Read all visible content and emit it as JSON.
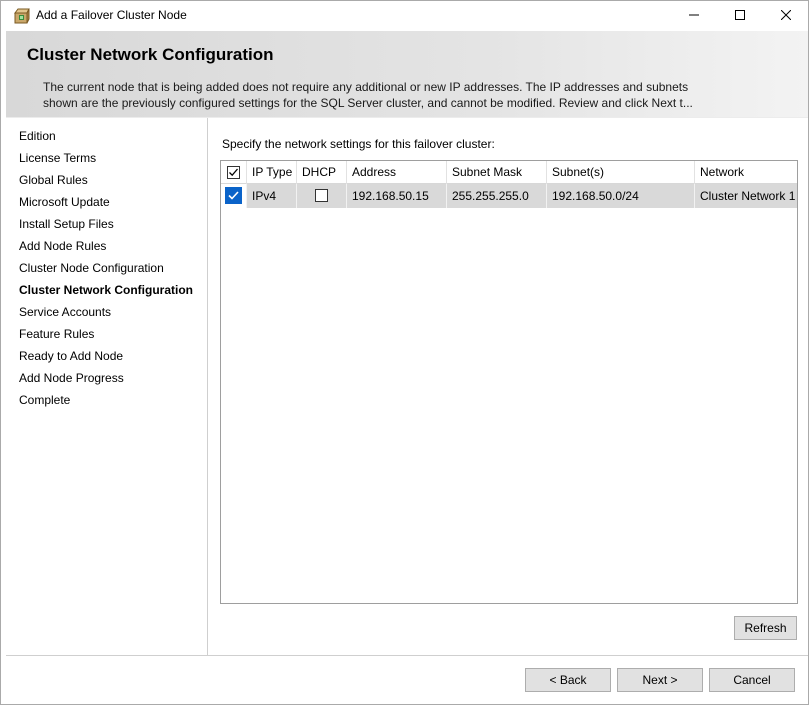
{
  "window": {
    "title": "Add a Failover Cluster Node"
  },
  "header": {
    "title": "Cluster Network Configuration",
    "desc_line1": "The current node that is being added does not require any additional or new IP addresses.  The IP addresses and subnets",
    "desc_line2": "shown are the previously configured settings for the SQL Server cluster, and cannot be modified. Review and click Next t..."
  },
  "nav": {
    "items": [
      {
        "label": "Edition"
      },
      {
        "label": "License Terms"
      },
      {
        "label": "Global Rules"
      },
      {
        "label": "Microsoft Update"
      },
      {
        "label": "Install Setup Files"
      },
      {
        "label": "Add Node Rules"
      },
      {
        "label": "Cluster Node Configuration"
      },
      {
        "label": "Cluster Network Configuration",
        "active": true
      },
      {
        "label": "Service Accounts"
      },
      {
        "label": "Feature Rules"
      },
      {
        "label": "Ready to Add Node"
      },
      {
        "label": "Add Node Progress"
      },
      {
        "label": "Complete"
      }
    ]
  },
  "main": {
    "prompt": "Specify the network settings for this failover cluster:",
    "columns": {
      "ip_type": "IP Type",
      "dhcp": "DHCP",
      "address": "Address",
      "subnet_mask": "Subnet Mask",
      "subnets": "Subnet(s)",
      "network": "Network"
    },
    "rows": [
      {
        "selected": true,
        "ip_type": "IPv4",
        "dhcp": false,
        "address": "192.168.50.15",
        "subnet_mask": "255.255.255.0",
        "subnets": "192.168.50.0/24",
        "network": "Cluster Network 1"
      }
    ]
  },
  "buttons": {
    "refresh": "Refresh",
    "back": "< Back",
    "next": "Next >",
    "cancel": "Cancel"
  },
  "colors": {
    "selected_checkbox": "#0a63c9",
    "row_selected_bg": "#d9d9d9"
  },
  "icons": {
    "app": "setup-box-icon",
    "minimize": "minimize-icon",
    "maximize": "maximize-icon",
    "close": "close-icon",
    "check": "checkmark-icon"
  }
}
